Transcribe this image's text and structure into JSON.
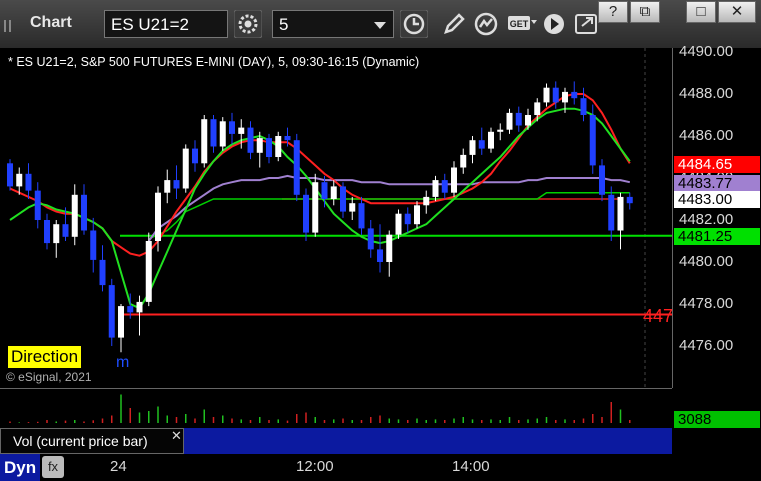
{
  "app": {
    "title": "Chart"
  },
  "toolbar": {
    "symbol": "ES U21=2",
    "interval": "5",
    "icons": [
      "gear-icon",
      "clock-icon",
      "pencil-icon",
      "indicator-icon",
      "get-icon",
      "play-icon",
      "export-icon"
    ]
  },
  "window": {
    "help_label": "?",
    "restore_label": "⧉",
    "maximize_label": "□",
    "close_label": "✕"
  },
  "legend": {
    "text": "* ES U21=2, S&P 500 FUTURES E-MINI (DAY), 5, 09:30-16:15 (Dynamic)"
  },
  "price_axis": {
    "ticks": [
      "4490.00",
      "4488.00",
      "4486.00",
      "4484.00",
      "4482.00",
      "4480.00",
      "4478.00",
      "4476.00"
    ],
    "tick_values": [
      4490,
      4488,
      4486,
      4484,
      4482,
      4480,
      4478,
      4476
    ],
    "markers": [
      {
        "label": "4484.65",
        "bg": "#ff0000",
        "fg": "#ffffff"
      },
      {
        "label": "4483.77",
        "bg": "#a080d0",
        "fg": "#000000"
      },
      {
        "label": "4483.00",
        "bg": "#ffffff",
        "fg": "#000000"
      },
      {
        "label": "4481.25",
        "bg": "#00e000",
        "fg": "#000000"
      }
    ],
    "red_level_label": "447"
  },
  "annotations": {
    "direction": "Direction",
    "copyright": "© eSignal, 2021",
    "partial_m": "m"
  },
  "volume": {
    "pane_label": "Vol (current price bar)",
    "value": "3088",
    "close_label": "✕"
  },
  "time_axis": {
    "labels": [
      "24",
      "12:00",
      "14:00"
    ],
    "dyn_label": "Dyn",
    "fx_label": "fx"
  },
  "chart_data": {
    "type": "candlestick",
    "ylim": [
      4475.0,
      4490.5
    ],
    "bars": [
      [
        4484.7,
        4484.9,
        4483.4,
        4483.6
      ],
      [
        4483.6,
        4484.5,
        4483.2,
        4484.2
      ],
      [
        4484.2,
        4484.7,
        4483.0,
        4483.4
      ],
      [
        4483.4,
        4483.8,
        4481.6,
        4482.0
      ],
      [
        4482.0,
        4482.3,
        4480.6,
        4480.9
      ],
      [
        4480.9,
        4482.0,
        4480.2,
        4481.8
      ],
      [
        4481.8,
        4482.6,
        4481.0,
        4481.2
      ],
      [
        4481.2,
        4483.7,
        4480.8,
        4483.2
      ],
      [
        4483.2,
        4483.7,
        4481.3,
        4481.5
      ],
      [
        4481.5,
        4482.1,
        4479.5,
        4480.1
      ],
      [
        4480.1,
        4480.8,
        4478.6,
        4478.9
      ],
      [
        4478.9,
        4479.2,
        4476.0,
        4476.4
      ],
      [
        4476.4,
        4478.0,
        4475.7,
        4477.9
      ],
      [
        4477.9,
        4478.5,
        4477.3,
        4477.6
      ],
      [
        4477.6,
        4478.4,
        4476.5,
        4478.1
      ],
      [
        4478.1,
        4481.4,
        4477.9,
        4481.0
      ],
      [
        4481.0,
        4483.6,
        4480.5,
        4483.3
      ],
      [
        4483.3,
        4484.4,
        4482.8,
        4483.9
      ],
      [
        4483.9,
        4484.6,
        4483.0,
        4483.5
      ],
      [
        4483.5,
        4485.6,
        4483.3,
        4485.4
      ],
      [
        4485.4,
        4485.8,
        4484.3,
        4484.7
      ],
      [
        4484.7,
        4487.0,
        4484.5,
        4486.8
      ],
      [
        4486.8,
        4487.0,
        4485.2,
        4485.5
      ],
      [
        4485.5,
        4486.9,
        4485.3,
        4486.7
      ],
      [
        4486.7,
        4487.1,
        4485.6,
        4486.1
      ],
      [
        4486.1,
        4486.8,
        4485.4,
        4486.4
      ],
      [
        4486.4,
        4486.7,
        4484.9,
        4485.2
      ],
      [
        4485.2,
        4486.2,
        4484.5,
        4485.9
      ],
      [
        4485.9,
        4486.1,
        4484.7,
        4485.0
      ],
      [
        4485.0,
        4486.2,
        4484.8,
        4486.0
      ],
      [
        4486.0,
        4486.4,
        4485.5,
        4485.8
      ],
      [
        4485.8,
        4486.1,
        4482.9,
        4483.2
      ],
      [
        4483.2,
        4483.5,
        4481.0,
        4481.4
      ],
      [
        4481.4,
        4484.2,
        4481.2,
        4483.8
      ],
      [
        4483.8,
        4484.1,
        4482.6,
        4483.0
      ],
      [
        4483.0,
        4483.9,
        4482.7,
        4483.6
      ],
      [
        4483.6,
        4483.8,
        4482.1,
        4482.4
      ],
      [
        4482.4,
        4483.1,
        4482.0,
        4482.8
      ],
      [
        4482.8,
        4483.1,
        4481.3,
        4481.6
      ],
      [
        4481.6,
        4482.0,
        4480.2,
        4480.6
      ],
      [
        4480.6,
        4481.8,
        4479.5,
        4480.0
      ],
      [
        4480.0,
        4481.5,
        4479.3,
        4481.3
      ],
      [
        4481.3,
        4482.5,
        4481.1,
        4482.3
      ],
      [
        4482.3,
        4482.6,
        4481.4,
        4481.8
      ],
      [
        4481.8,
        4482.9,
        4481.6,
        4482.7
      ],
      [
        4482.7,
        4483.4,
        4482.3,
        4483.1
      ],
      [
        4483.1,
        4484.1,
        4482.9,
        4483.9
      ],
      [
        4483.9,
        4484.2,
        4483.0,
        4483.3
      ],
      [
        4483.3,
        4484.8,
        4483.1,
        4484.5
      ],
      [
        4484.5,
        4485.4,
        4484.2,
        4485.1
      ],
      [
        4485.1,
        4486.0,
        4484.7,
        4485.8
      ],
      [
        4485.8,
        4486.4,
        4485.1,
        4485.4
      ],
      [
        4485.4,
        4486.4,
        4485.2,
        4486.2
      ],
      [
        4486.2,
        4486.6,
        4485.8,
        4486.3
      ],
      [
        4486.3,
        4487.3,
        4486.1,
        4487.1
      ],
      [
        4487.1,
        4487.4,
        4486.2,
        4486.5
      ],
      [
        4486.5,
        4487.3,
        4486.3,
        4487.0
      ],
      [
        4487.0,
        4487.8,
        4486.7,
        4487.6
      ],
      [
        4487.6,
        4488.5,
        4487.4,
        4488.3
      ],
      [
        4488.3,
        4488.6,
        4487.3,
        4487.6
      ],
      [
        4487.6,
        4488.3,
        4487.1,
        4488.1
      ],
      [
        4488.1,
        4488.6,
        4487.5,
        4487.8
      ],
      [
        4487.8,
        4488.3,
        4486.7,
        4487.0
      ],
      [
        4487.0,
        4487.5,
        4484.2,
        4484.6
      ],
      [
        4484.6,
        4484.9,
        4482.9,
        4483.2
      ],
      [
        4483.2,
        4483.6,
        4481.0,
        4481.5
      ],
      [
        4481.5,
        4483.3,
        4480.6,
        4483.1
      ],
      [
        4483.1,
        4483.3,
        4482.5,
        4482.8
      ]
    ],
    "red_ma": [
      4483.5,
      4483.3,
      4483.1,
      4482.9,
      4482.6,
      4482.4,
      4482.3,
      4482.3,
      4482.1,
      4481.9,
      4481.6,
      4481.0,
      4480.7,
      4480.4,
      4480.3,
      4480.5,
      4481.0,
      4481.7,
      4482.4,
      4483.0,
      4483.6,
      4484.3,
      4484.8,
      4485.2,
      4485.5,
      4485.7,
      4485.8,
      4485.8,
      4485.7,
      4485.7,
      4485.7,
      4485.4,
      4485.0,
      4484.6,
      4484.2,
      4483.9,
      4483.5,
      4483.2,
      4483.0,
      4482.8,
      4482.8,
      4482.8,
      4482.8,
      4482.8,
      4482.8,
      4482.8,
      4482.9,
      4483.0,
      4483.1,
      4483.3,
      4483.5,
      4483.8,
      4484.2,
      4484.8,
      4485.3,
      4485.9,
      4486.5,
      4486.9,
      4487.3,
      4487.6,
      4487.9,
      4488.0,
      4488.0,
      4487.7,
      4487.1,
      4486.3,
      4485.4,
      4484.7
    ],
    "green_ma": [
      4482.0,
      4482.3,
      4482.6,
      4482.8,
      4482.7,
      4482.5,
      4482.4,
      4482.3,
      4482.1,
      4481.9,
      4481.6,
      4481.0,
      4479.5,
      4478.0,
      4477.8,
      4478.5,
      4479.5,
      4480.5,
      4481.5,
      4482.5,
      4483.5,
      4484.2,
      4484.8,
      4485.3,
      4485.6,
      4485.8,
      4485.9,
      4486.0,
      4485.8,
      4485.5,
      4485.0,
      4484.6,
      4484.1,
      4483.5,
      4482.9,
      4482.3,
      4481.9,
      4481.5,
      4481.2,
      4481.0,
      4480.9,
      4481.0,
      4481.2,
      4481.4,
      4481.6,
      4481.8,
      4482.2,
      4482.6,
      4483.0,
      4483.4,
      4483.8,
      4484.2,
      4484.6,
      4485.0,
      4485.5,
      4486.0,
      4486.4,
      4486.8,
      4487.1,
      4487.2,
      4487.3,
      4487.3,
      4487.2,
      4487.0,
      4486.6,
      4486.0,
      4485.4,
      4484.8
    ],
    "purple_vwap": [
      null,
      null,
      null,
      null,
      null,
      null,
      null,
      null,
      null,
      null,
      null,
      null,
      null,
      null,
      null,
      4481.0,
      4481.6,
      4481.9,
      4482.2,
      4482.6,
      4482.9,
      4483.2,
      4483.5,
      4483.7,
      4483.8,
      4483.9,
      4483.9,
      4483.9,
      4484.0,
      4484.0,
      4484.1,
      4484.0,
      4484.0,
      4484.0,
      4483.9,
      4483.9,
      4483.9,
      4483.9,
      4483.8,
      4483.8,
      4483.8,
      4483.7,
      4483.7,
      4483.7,
      4483.7,
      4483.7,
      4483.7,
      4483.7,
      4483.7,
      4483.7,
      4483.7,
      4483.8,
      4483.8,
      4483.8,
      4483.8,
      4483.8,
      4483.9,
      4483.9,
      4484.0,
      4484.0,
      4484.0,
      4484.0,
      4484.0,
      4484.0,
      4484.0,
      4483.9,
      4483.9,
      4483.8
    ],
    "green_step": [
      null,
      null,
      null,
      null,
      null,
      null,
      null,
      null,
      null,
      null,
      null,
      null,
      null,
      null,
      null,
      4481.1,
      4481.3,
      4481.5,
      4481.9,
      4482.4,
      4482.6,
      4482.8,
      4483.0,
      4483.0,
      4483.0,
      4483.0,
      4483.0,
      4483.0,
      4483.0,
      4483.0,
      4483.0,
      4483.0,
      4483.0,
      4483.0,
      4483.0,
      4483.0,
      4483.0,
      4483.0,
      4483.0,
      4483.0,
      4483.0,
      4483.0,
      4483.0,
      4483.0,
      4483.0,
      4483.0,
      4483.0,
      4483.0,
      4483.0,
      4483.0,
      4483.0,
      4483.0,
      4483.0,
      4483.0,
      4483.0,
      4483.0,
      4483.0,
      4483.0,
      4483.3,
      4483.3,
      4483.3,
      4483.3,
      4483.3,
      4483.3,
      4483.3,
      4483.3,
      4483.3,
      4483.3
    ],
    "red_level": 4477.5,
    "red_flat": 4483.0,
    "green_flat": 4481.25,
    "volume": [
      0.05,
      0.02,
      0.03,
      0.04,
      0.1,
      0.05,
      0.08,
      0.1,
      0.05,
      0.09,
      0.15,
      0.25,
      0.95,
      0.5,
      0.35,
      0.4,
      0.55,
      0.25,
      0.2,
      0.3,
      0.15,
      0.45,
      0.2,
      0.25,
      0.15,
      0.12,
      0.1,
      0.2,
      0.1,
      0.12,
      0.08,
      0.3,
      0.35,
      0.2,
      0.1,
      0.12,
      0.15,
      0.1,
      0.1,
      0.2,
      0.25,
      0.15,
      0.12,
      0.1,
      0.15,
      0.1,
      0.12,
      0.1,
      0.15,
      0.2,
      0.12,
      0.1,
      0.12,
      0.1,
      0.2,
      0.1,
      0.12,
      0.15,
      0.2,
      0.1,
      0.12,
      0.1,
      0.15,
      0.3,
      0.2,
      0.7,
      0.45,
      0.1
    ]
  }
}
